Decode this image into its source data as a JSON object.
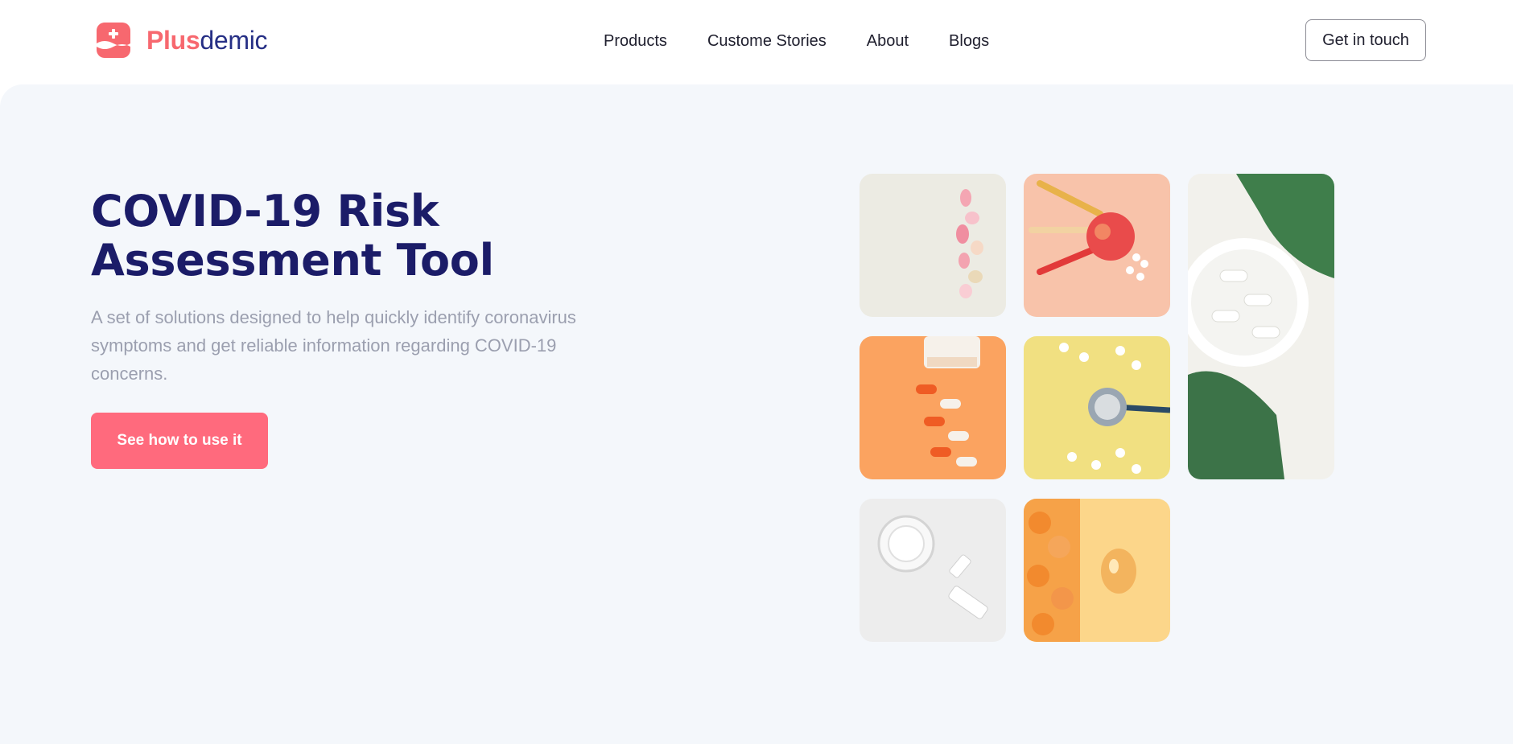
{
  "brand": {
    "name_part1": "Plus",
    "name_part2": "demic",
    "accent": "#f7686f",
    "dark": "#262f85"
  },
  "nav": {
    "items": [
      {
        "label": "Products"
      },
      {
        "label": "Custome Stories"
      },
      {
        "label": "About"
      },
      {
        "label": "Blogs"
      }
    ],
    "cta_label": "Get in touch"
  },
  "hero": {
    "title_line1": "COVID-19 Risk",
    "title_line2": "Assessment Tool",
    "subtitle": "A set of solutions designed to help quickly identify coronavirus symptoms and get reliable information regarding COVID-19 concerns.",
    "cta_label": "See how to use it",
    "cta_color": "#ff6a7d",
    "title_color": "#1b1c68"
  },
  "gallery": {
    "tiles": [
      {
        "icon": "pink-pills-image"
      },
      {
        "icon": "apple-syringes-image"
      },
      {
        "icon": "white-capsules-leaves-image"
      },
      {
        "icon": "orange-pill-bottle-image"
      },
      {
        "icon": "stethoscope-pills-image"
      },
      {
        "icon": "glass-vials-image"
      },
      {
        "icon": "oil-capsules-image"
      }
    ]
  }
}
